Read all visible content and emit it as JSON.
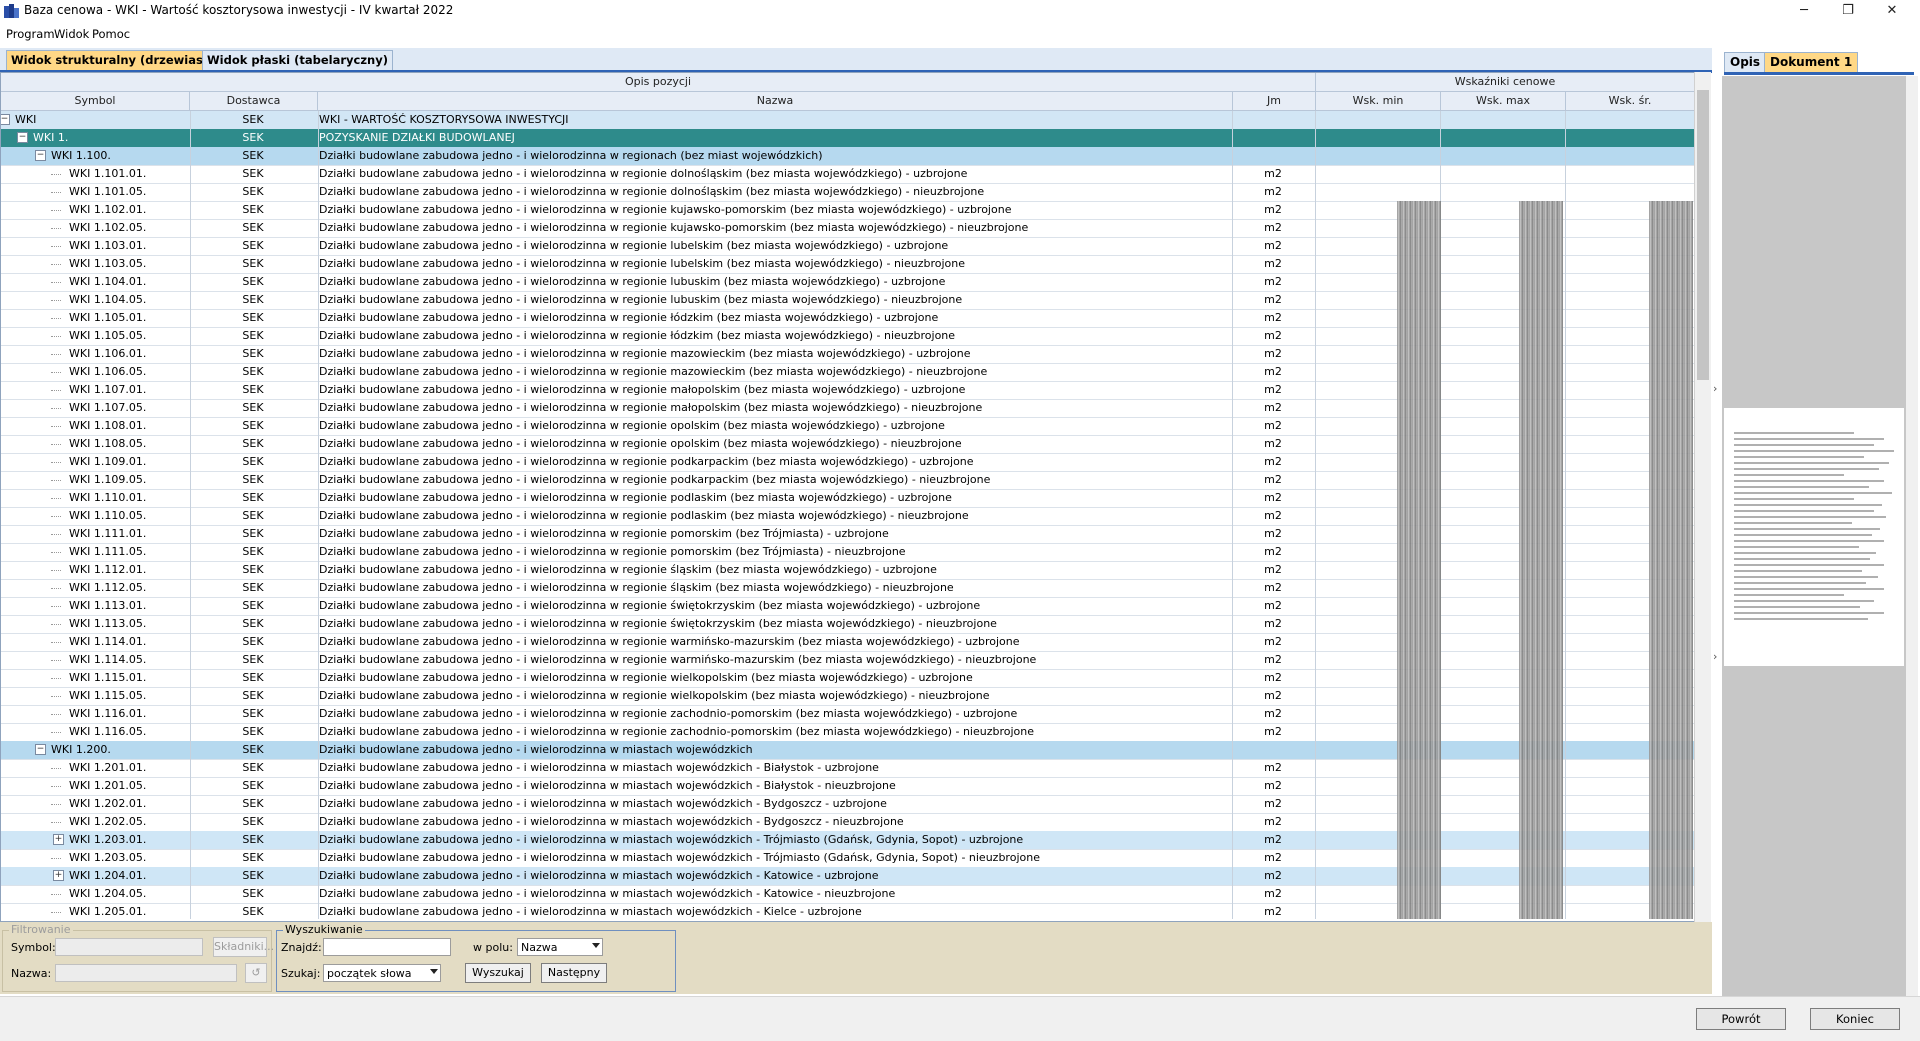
{
  "window": {
    "title": "Baza cenowa - WKI - Wartość kosztorysowa inwestycji - IV kwartał 2022",
    "minimize": "─",
    "maximize": "❐",
    "close": "✕"
  },
  "menu": [
    "Program",
    "Widok",
    "Pomoc"
  ],
  "tabs": {
    "structural": "Widok strukturalny (drzewiasty)",
    "flat": "Widok płaski (tabelaryczny)"
  },
  "grid": {
    "group_desc": "Opis pozycji",
    "group_prices": "Wskaźniki cenowe",
    "columns": {
      "symbol": "Symbol",
      "dostawca": "Dostawca",
      "nazwa": "Nazwa",
      "jm": "Jm",
      "wsk_min": "Wsk. min",
      "wsk_max": "Wsk. max",
      "wsk_sr": "Wsk. śr."
    },
    "rows": [
      {
        "symbol": "WKI",
        "dostawca": "SEK",
        "nazwa": "WKI - WARTOŚĆ KOSZTORYSOWA INWESTYCJI",
        "jm": "",
        "level": 0,
        "style": "l0",
        "toggle": "−"
      },
      {
        "symbol": "WKI 1.",
        "dostawca": "SEK",
        "nazwa": "POZYSKANIE DZIAŁKI BUDOWLANEJ",
        "jm": "",
        "level": 1,
        "style": "l1",
        "toggle": "−"
      },
      {
        "symbol": "WKI 1.100.",
        "dostawca": "SEK",
        "nazwa": "Działki budowlane zabudowa jedno - i wielorodzinna w regionach (bez miast wojewódzkich)",
        "jm": "",
        "level": 2,
        "style": "l2",
        "toggle": "−"
      },
      {
        "symbol": "WKI 1.101.01.",
        "dostawca": "SEK",
        "nazwa": "Działki budowlane zabudowa jedno - i wielorodzinna w regionie dolnośląskim (bez miasta wojewódzkiego) - uzbrojone",
        "jm": "m2",
        "level": 3
      },
      {
        "symbol": "WKI 1.101.05.",
        "dostawca": "SEK",
        "nazwa": "Działki budowlane zabudowa jedno - i wielorodzinna w regionie dolnośląskim (bez miasta wojewódzkiego) - nieuzbrojone",
        "jm": "m2",
        "level": 3
      },
      {
        "symbol": "WKI 1.102.01.",
        "dostawca": "SEK",
        "nazwa": "Działki budowlane zabudowa jedno - i wielorodzinna w regionie kujawsko-pomorskim (bez miasta wojewódzkiego) - uzbrojone",
        "jm": "m2",
        "level": 3
      },
      {
        "symbol": "WKI 1.102.05.",
        "dostawca": "SEK",
        "nazwa": "Działki budowlane zabudowa jedno - i wielorodzinna w regionie kujawsko-pomorskim (bez miasta wojewódzkiego) - nieuzbrojone",
        "jm": "m2",
        "level": 3
      },
      {
        "symbol": "WKI 1.103.01.",
        "dostawca": "SEK",
        "nazwa": "Działki budowlane zabudowa jedno - i wielorodzinna w regionie lubelskim (bez miasta wojewódzkiego) - uzbrojone",
        "jm": "m2",
        "level": 3
      },
      {
        "symbol": "WKI 1.103.05.",
        "dostawca": "SEK",
        "nazwa": "Działki budowlane zabudowa jedno - i wielorodzinna w regionie lubelskim (bez miasta wojewódzkiego) - nieuzbrojone",
        "jm": "m2",
        "level": 3
      },
      {
        "symbol": "WKI 1.104.01.",
        "dostawca": "SEK",
        "nazwa": "Działki budowlane zabudowa jedno - i wielorodzinna w regionie lubuskim (bez miasta wojewódzkiego) - uzbrojone",
        "jm": "m2",
        "level": 3
      },
      {
        "symbol": "WKI 1.104.05.",
        "dostawca": "SEK",
        "nazwa": "Działki budowlane zabudowa jedno - i wielorodzinna w regionie lubuskim (bez miasta wojewódzkiego) - nieuzbrojone",
        "jm": "m2",
        "level": 3
      },
      {
        "symbol": "WKI 1.105.01.",
        "dostawca": "SEK",
        "nazwa": "Działki budowlane zabudowa jedno - i wielorodzinna w regionie łódzkim (bez miasta wojewódzkiego) - uzbrojone",
        "jm": "m2",
        "level": 3
      },
      {
        "symbol": "WKI 1.105.05.",
        "dostawca": "SEK",
        "nazwa": "Działki budowlane zabudowa jedno - i wielorodzinna w regionie łódzkim (bez miasta wojewódzkiego) - nieuzbrojone",
        "jm": "m2",
        "level": 3
      },
      {
        "symbol": "WKI 1.106.01.",
        "dostawca": "SEK",
        "nazwa": "Działki budowlane zabudowa jedno - i wielorodzinna w regionie mazowieckim (bez miasta wojewódzkiego) - uzbrojone",
        "jm": "m2",
        "level": 3
      },
      {
        "symbol": "WKI 1.106.05.",
        "dostawca": "SEK",
        "nazwa": "Działki budowlane zabudowa jedno - i wielorodzinna w regionie mazowieckim (bez miasta wojewódzkiego) - nieuzbrojone",
        "jm": "m2",
        "level": 3
      },
      {
        "symbol": "WKI 1.107.01.",
        "dostawca": "SEK",
        "nazwa": "Działki budowlane zabudowa jedno - i wielorodzinna w regionie małopolskim (bez miasta wojewódzkiego) - uzbrojone",
        "jm": "m2",
        "level": 3
      },
      {
        "symbol": "WKI 1.107.05.",
        "dostawca": "SEK",
        "nazwa": "Działki budowlane zabudowa jedno - i wielorodzinna w regionie małopolskim (bez miasta wojewódzkiego) - nieuzbrojone",
        "jm": "m2",
        "level": 3
      },
      {
        "symbol": "WKI 1.108.01.",
        "dostawca": "SEK",
        "nazwa": "Działki budowlane zabudowa jedno - i wielorodzinna w regionie opolskim (bez miasta wojewódzkiego) - uzbrojone",
        "jm": "m2",
        "level": 3
      },
      {
        "symbol": "WKI 1.108.05.",
        "dostawca": "SEK",
        "nazwa": "Działki budowlane zabudowa jedno - i wielorodzinna w regionie opolskim (bez miasta wojewódzkiego) - nieuzbrojone",
        "jm": "m2",
        "level": 3
      },
      {
        "symbol": "WKI 1.109.01.",
        "dostawca": "SEK",
        "nazwa": "Działki budowlane zabudowa jedno - i wielorodzinna w regionie podkarpackim (bez miasta wojewódzkiego) - uzbrojone",
        "jm": "m2",
        "level": 3
      },
      {
        "symbol": "WKI 1.109.05.",
        "dostawca": "SEK",
        "nazwa": "Działki budowlane zabudowa jedno - i wielorodzinna w regionie podkarpackim (bez miasta wojewódzkiego) - nieuzbrojone",
        "jm": "m2",
        "level": 3
      },
      {
        "symbol": "WKI 1.110.01.",
        "dostawca": "SEK",
        "nazwa": "Działki budowlane zabudowa jedno - i wielorodzinna w regionie podlaskim (bez miasta wojewódzkiego) - uzbrojone",
        "jm": "m2",
        "level": 3
      },
      {
        "symbol": "WKI 1.110.05.",
        "dostawca": "SEK",
        "nazwa": "Działki budowlane zabudowa jedno - i wielorodzinna w regionie podlaskim (bez miasta wojewódzkiego) - nieuzbrojone",
        "jm": "m2",
        "level": 3
      },
      {
        "symbol": "WKI 1.111.01.",
        "dostawca": "SEK",
        "nazwa": "Działki budowlane zabudowa jedno - i wielorodzinna w regionie pomorskim (bez Trójmiasta) - uzbrojone",
        "jm": "m2",
        "level": 3
      },
      {
        "symbol": "WKI 1.111.05.",
        "dostawca": "SEK",
        "nazwa": "Działki budowlane zabudowa jedno - i wielorodzinna w regionie pomorskim (bez Trójmiasta) - nieuzbrojone",
        "jm": "m2",
        "level": 3
      },
      {
        "symbol": "WKI 1.112.01.",
        "dostawca": "SEK",
        "nazwa": "Działki budowlane zabudowa jedno - i wielorodzinna w regionie śląskim (bez miasta wojewódzkiego) - uzbrojone",
        "jm": "m2",
        "level": 3
      },
      {
        "symbol": "WKI 1.112.05.",
        "dostawca": "SEK",
        "nazwa": "Działki budowlane zabudowa jedno - i wielorodzinna w regionie śląskim (bez miasta wojewódzkiego) - nieuzbrojone",
        "jm": "m2",
        "level": 3
      },
      {
        "symbol": "WKI 1.113.01.",
        "dostawca": "SEK",
        "nazwa": "Działki budowlane zabudowa jedno - i wielorodzinna w regionie świętokrzyskim (bez miasta wojewódzkiego) - uzbrojone",
        "jm": "m2",
        "level": 3
      },
      {
        "symbol": "WKI 1.113.05.",
        "dostawca": "SEK",
        "nazwa": "Działki budowlane zabudowa jedno - i wielorodzinna w regionie świętokrzyskim (bez miasta wojewódzkiego) - nieuzbrojone",
        "jm": "m2",
        "level": 3
      },
      {
        "symbol": "WKI 1.114.01.",
        "dostawca": "SEK",
        "nazwa": "Działki budowlane zabudowa jedno - i wielorodzinna w regionie warmińsko-mazurskim (bez miasta wojewódzkiego) - uzbrojone",
        "jm": "m2",
        "level": 3
      },
      {
        "symbol": "WKI 1.114.05.",
        "dostawca": "SEK",
        "nazwa": "Działki budowlane zabudowa jedno - i wielorodzinna w regionie warmińsko-mazurskim (bez miasta wojewódzkiego) - nieuzbrojone",
        "jm": "m2",
        "level": 3
      },
      {
        "symbol": "WKI 1.115.01.",
        "dostawca": "SEK",
        "nazwa": "Działki budowlane zabudowa jedno - i wielorodzinna w regionie wielkopolskim (bez miasta wojewódzkiego) - uzbrojone",
        "jm": "m2",
        "level": 3
      },
      {
        "symbol": "WKI 1.115.05.",
        "dostawca": "SEK",
        "nazwa": "Działki budowlane zabudowa jedno - i wielorodzinna w regionie wielkopolskim (bez miasta wojewódzkiego) - nieuzbrojone",
        "jm": "m2",
        "level": 3
      },
      {
        "symbol": "WKI 1.116.01.",
        "dostawca": "SEK",
        "nazwa": "Działki budowlane zabudowa jedno - i wielorodzinna w regionie zachodnio-pomorskim (bez miasta wojewódzkiego) - uzbrojone",
        "jm": "m2",
        "level": 3
      },
      {
        "symbol": "WKI 1.116.05.",
        "dostawca": "SEK",
        "nazwa": "Działki budowlane zabudowa jedno - i wielorodzinna w regionie zachodnio-pomorskim (bez miasta wojewódzkiego) - nieuzbrojone",
        "jm": "m2",
        "level": 3
      },
      {
        "symbol": "WKI 1.200.",
        "dostawca": "SEK",
        "nazwa": "Działki budowlane zabudowa jedno - i wielorodzinna w miastach wojewódzkich",
        "jm": "",
        "level": 2,
        "style": "l2",
        "toggle": "−"
      },
      {
        "symbol": "WKI 1.201.01.",
        "dostawca": "SEK",
        "nazwa": "Działki budowlane zabudowa jedno - i wielorodzinna w miastach wojewódzkich - Białystok - uzbrojone",
        "jm": "m2",
        "level": 3
      },
      {
        "symbol": "WKI 1.201.05.",
        "dostawca": "SEK",
        "nazwa": "Działki budowlane zabudowa jedno - i wielorodzinna w miastach wojewódzkich - Białystok - nieuzbrojone",
        "jm": "m2",
        "level": 3
      },
      {
        "symbol": "WKI 1.202.01.",
        "dostawca": "SEK",
        "nazwa": "Działki budowlane zabudowa jedno - i wielorodzinna w miastach wojewódzkich - Bydgoszcz - uzbrojone",
        "jm": "m2",
        "level": 3
      },
      {
        "symbol": "WKI 1.202.05.",
        "dostawca": "SEK",
        "nazwa": "Działki budowlane zabudowa jedno - i wielorodzinna w miastach wojewódzkich - Bydgoszcz - nieuzbrojone",
        "jm": "m2",
        "level": 3
      },
      {
        "symbol": "WKI 1.203.01.",
        "dostawca": "SEK",
        "nazwa": "Działki budowlane zabudowa jedno - i wielorodzinna w miastach wojewódzkich - Trójmiasto (Gdańsk, Gdynia, Sopot) - uzbrojone",
        "jm": "m2",
        "level": 3,
        "style": "hl",
        "toggle": "+"
      },
      {
        "symbol": "WKI 1.203.05.",
        "dostawca": "SEK",
        "nazwa": "Działki budowlane zabudowa jedno - i wielorodzinna w miastach wojewódzkich - Trójmiasto (Gdańsk, Gdynia, Sopot) - nieuzbrojone",
        "jm": "m2",
        "level": 3
      },
      {
        "symbol": "WKI 1.204.01.",
        "dostawca": "SEK",
        "nazwa": "Działki budowlane zabudowa jedno - i wielorodzinna w miastach wojewódzkich - Katowice - uzbrojone",
        "jm": "m2",
        "level": 3,
        "style": "hl",
        "toggle": "+"
      },
      {
        "symbol": "WKI 1.204.05.",
        "dostawca": "SEK",
        "nazwa": "Działki budowlane zabudowa jedno - i wielorodzinna w miastach wojewódzkich - Katowice - nieuzbrojone",
        "jm": "m2",
        "level": 3
      },
      {
        "symbol": "WKI 1.205.01.",
        "dostawca": "SEK",
        "nazwa": "Działki budowlane zabudowa jedno - i wielorodzinna w miastach wojewódzkich - Kielce - uzbrojone",
        "jm": "m2",
        "level": 3
      }
    ]
  },
  "filter": {
    "legend": "Filtrowanie",
    "symbol_label": "Symbol:",
    "nazwa_label": "Nazwa:",
    "skladniki_button": "Składniki...",
    "clear_button": "↺"
  },
  "search": {
    "legend": "Wyszukiwanie",
    "find_label": "Znajdź:",
    "field_label": "w polu:",
    "field_value": "Nazwa",
    "mode_label": "Szukaj:",
    "mode_value": "początek słowa",
    "search_button": "Wyszukaj",
    "next_button": "Następny"
  },
  "right_panel": {
    "tab_opis": "Opis",
    "tab_doc": "Dokument 1"
  },
  "footer": {
    "back_button": "Powrót",
    "end_button": "Koniec"
  }
}
